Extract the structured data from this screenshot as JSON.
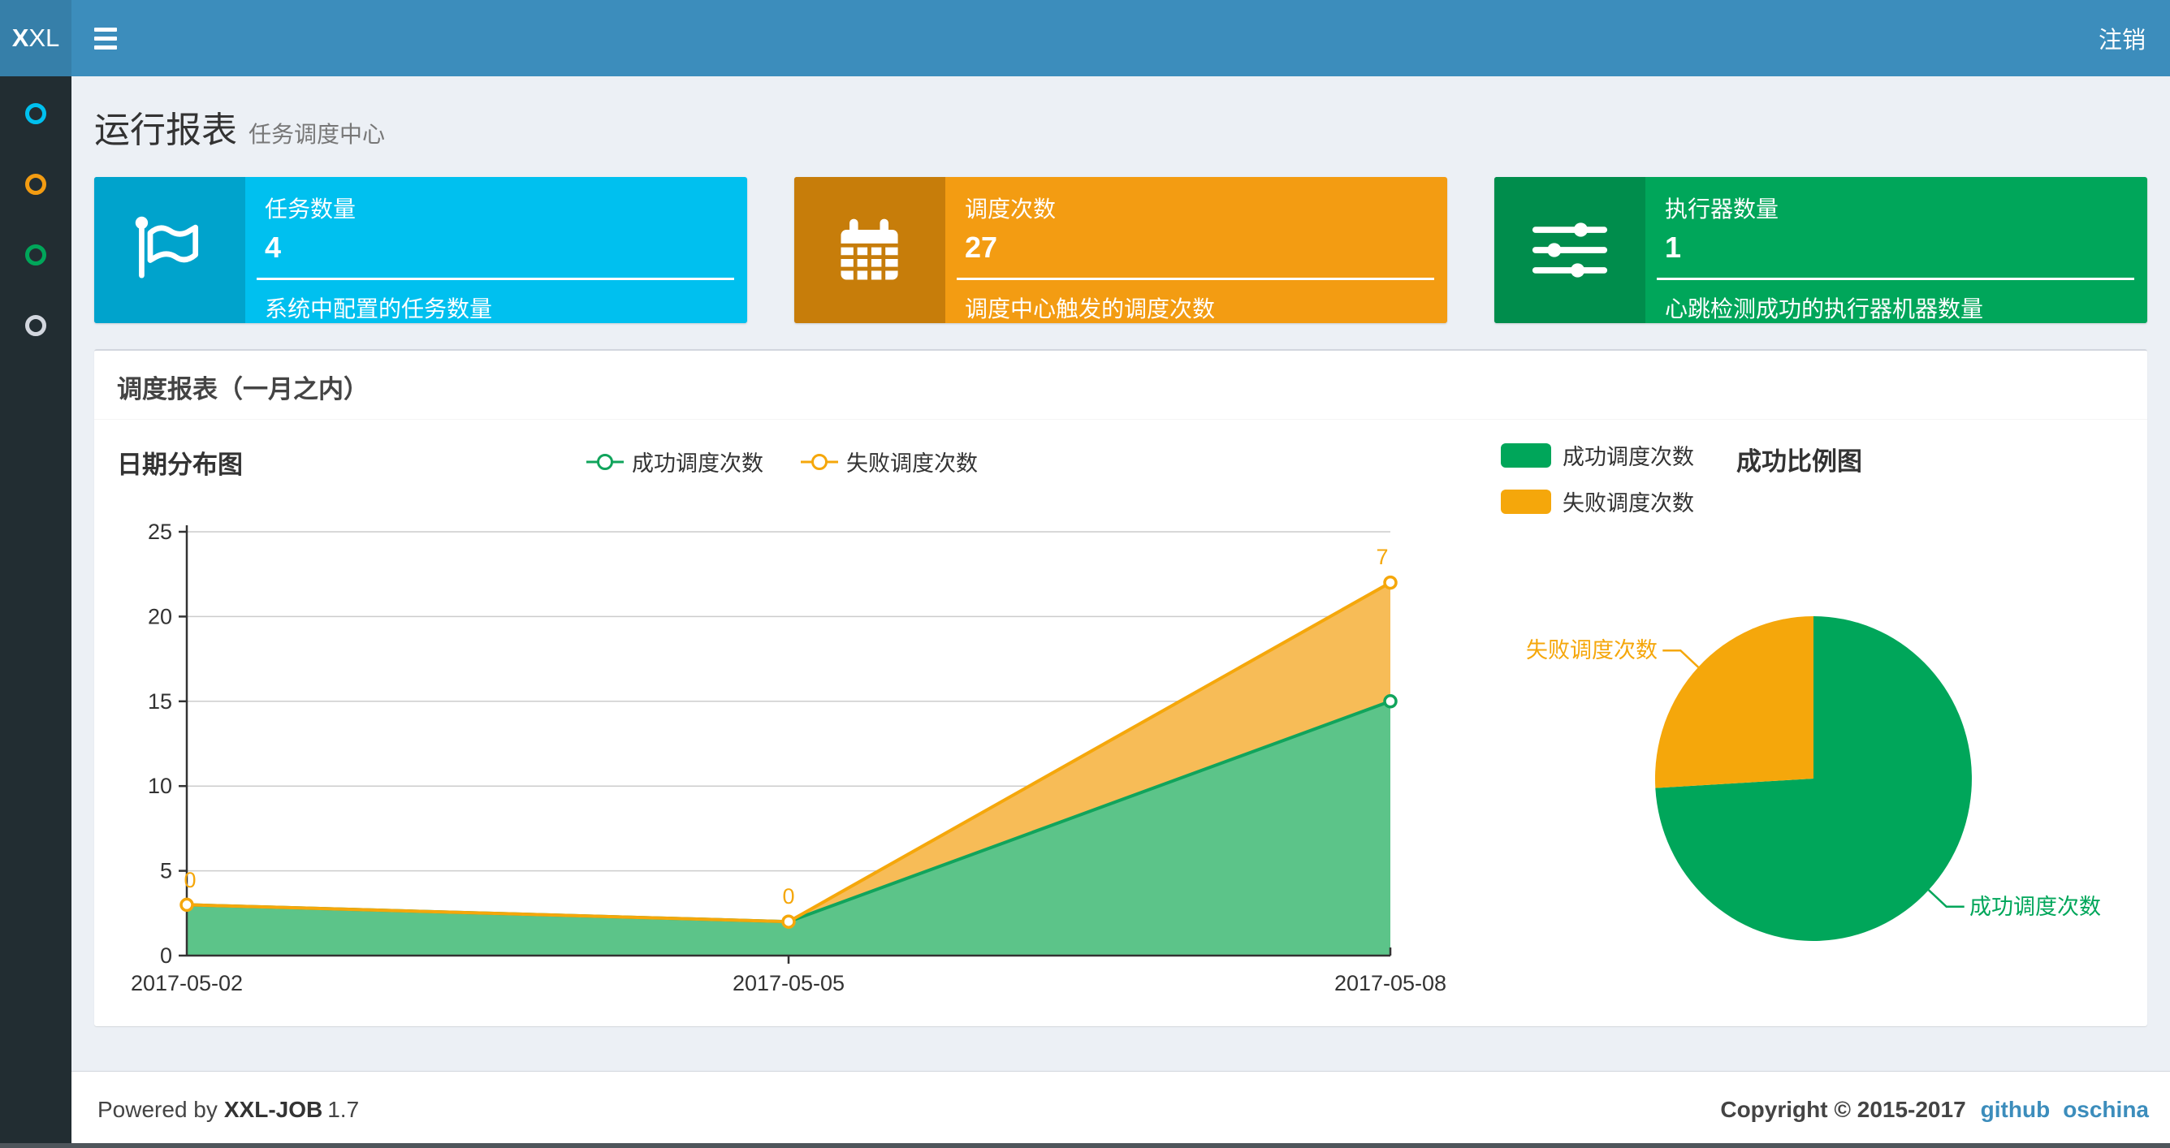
{
  "header": {
    "logo_bold": "X",
    "logo_rest": "XL",
    "logout_label": "注销"
  },
  "sidebar": {
    "items": [
      {
        "name": "report-menu-item",
        "color": "#00c0ef"
      },
      {
        "name": "job-menu-item",
        "color": "#f39c12"
      },
      {
        "name": "executor-menu-item",
        "color": "#00a65a"
      },
      {
        "name": "help-menu-item",
        "color": "#d2d6de"
      }
    ]
  },
  "page": {
    "title": "运行报表",
    "subtitle": "任务调度中心"
  },
  "stats": [
    {
      "label": "任务数量",
      "value": "4",
      "desc": "系统中配置的任务数量",
      "color": "#00c0ef",
      "icon": "flag-icon"
    },
    {
      "label": "调度次数",
      "value": "27",
      "desc": "调度中心触发的调度次数",
      "color": "#f39c12",
      "icon": "calendar-icon"
    },
    {
      "label": "执行器数量",
      "value": "1",
      "desc": "心跳检测成功的执行器机器数量",
      "color": "#00a65a",
      "icon": "sliders-icon"
    }
  ],
  "panel": {
    "title": "调度报表（一月之内）"
  },
  "chart_data": [
    {
      "type": "area",
      "title": "日期分布图",
      "stacked": true,
      "x": [
        "2017-05-02",
        "2017-05-05",
        "2017-05-08"
      ],
      "series": [
        {
          "name": "成功调度次数",
          "values": [
            3,
            2,
            15
          ],
          "color": "#11a45c",
          "fill": "#5cc489"
        },
        {
          "name": "失败调度次数",
          "values": [
            0,
            0,
            7
          ],
          "color": "#f5a70b",
          "fill": "#f7bc57"
        }
      ],
      "yticks": [
        0,
        5,
        10,
        15,
        20,
        25
      ],
      "ylim": [
        0,
        25
      ],
      "grid": true,
      "legend_position": "top",
      "point_label_color": "#f5a70b"
    },
    {
      "type": "pie",
      "title": "成功比例图",
      "labels": [
        "成功调度次数",
        "失败调度次数"
      ],
      "values": [
        20,
        7
      ],
      "colors": [
        "#00a65a",
        "#f5a70b"
      ],
      "legend_position": "top-left"
    }
  ],
  "footer": {
    "powered_prefix": "Powered by",
    "product": "XXL-JOB",
    "version": "1.7",
    "copyright": "Copyright © 2015-2017",
    "links": [
      {
        "label": "github"
      },
      {
        "label": "oschina"
      }
    ]
  }
}
